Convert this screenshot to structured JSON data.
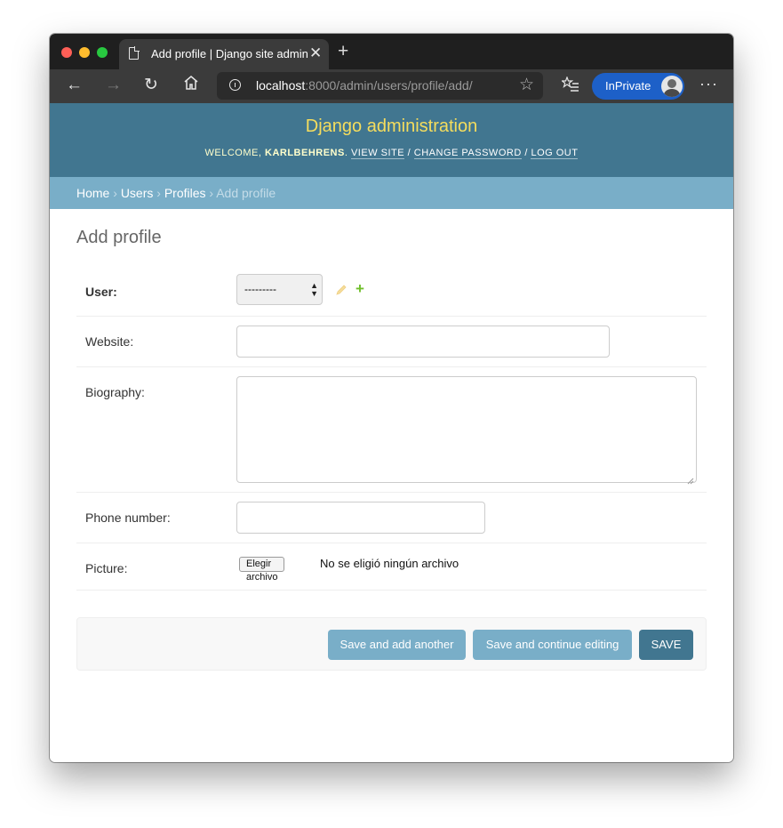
{
  "browser": {
    "tab_title": "Add profile | Django site admin",
    "url_host": "localhost",
    "url_path": ":8000/admin/users/profile/add/",
    "profile_label": "InPrivate",
    "icons": [
      "back-icon",
      "forward-icon",
      "reload-icon",
      "home-icon",
      "info-icon",
      "favorite-star-icon",
      "favorites-list-icon",
      "more-icon"
    ]
  },
  "header": {
    "site_name": "Django administration",
    "welcome": "WELCOME,",
    "username": "KARLBEHRENS",
    "view_site": "VIEW SITE",
    "change_password": "CHANGE PASSWORD",
    "log_out": "LOG OUT"
  },
  "breadcrumbs": {
    "home": "Home",
    "users": "Users",
    "profiles": "Profiles",
    "current": "Add profile",
    "separator": "›"
  },
  "page": {
    "title": "Add profile"
  },
  "form": {
    "user_label": "User:",
    "user_selected": "---------",
    "website_label": "Website:",
    "website_value": "",
    "biography_label": "Biography:",
    "biography_value": "",
    "phone_label": "Phone number:",
    "phone_value": "",
    "picture_label": "Picture:",
    "picture_button": "Elegir archivo",
    "picture_status": "No se eligió ningún archivo"
  },
  "actions": {
    "save_add_another": "Save and add another",
    "save_continue": "Save and continue editing",
    "save": "SAVE"
  },
  "colors": {
    "header_bg": "#417690",
    "site_name": "#f5dd5d",
    "breadcrumbs_bg": "#79aec8",
    "button_light": "#79aec8",
    "button_dark": "#417690",
    "add_icon": "#70bf2b",
    "inprivate_bg": "#1d60c8"
  }
}
